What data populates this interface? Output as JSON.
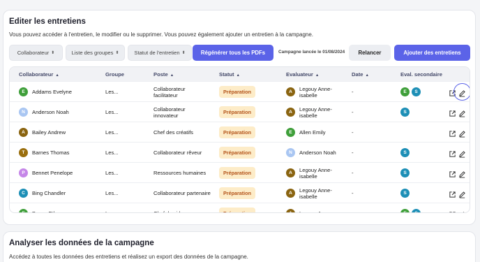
{
  "section1": {
    "title": "Editer les entretiens",
    "description": "Vous pouvez accéder à l'entretien, le modifier ou le supprimer. Vous pouvez également ajouter un entretien à la campagne."
  },
  "filters": {
    "collaborateur": "Collaborateur",
    "groupes": "Liste des groupes",
    "statut": "Statut de l'entretien"
  },
  "actions": {
    "regenerate": "Régénérer tous les PDFs",
    "campaign_info": "Campagne lancée le 01/08/2024",
    "relancer": "Relancer",
    "add": "Ajouter des entretiens"
  },
  "table": {
    "headers": {
      "collaborateur": "Collaborateur",
      "groupe": "Groupe",
      "poste": "Poste",
      "statut": "Statut",
      "evaluateur": "Evaluateur",
      "date": "Date",
      "eval_secondaire": "Eval. secondaire"
    },
    "rows": [
      {
        "avatar": "E",
        "name": "Addams Evelyne",
        "groupe": "Les...",
        "poste1": "Collaborateur",
        "poste2": "facilitateur",
        "statut": "Préparation",
        "eval_avatar": "A",
        "eval1": "Legouy Anne-",
        "eval2": "isabelle",
        "date": "-",
        "sec1": "E",
        "sec2": "S"
      },
      {
        "avatar": "N",
        "name": "Anderson Noah",
        "groupe": "Les...",
        "poste1": "Collaborateur",
        "poste2": "innovateur",
        "statut": "Préparation",
        "eval_avatar": "A",
        "eval1": "Legouy Anne-",
        "eval2": "isabelle",
        "date": "-",
        "sec1": "S",
        "sec2": ""
      },
      {
        "avatar": "A",
        "name": "Bailey Andrew",
        "groupe": "Les...",
        "poste1": "Chef des créatifs",
        "poste2": "",
        "statut": "Préparation",
        "eval_avatar": "E",
        "eval1": "Allen Emily",
        "eval2": "",
        "date": "-",
        "sec1": "",
        "sec2": ""
      },
      {
        "avatar": "T",
        "name": "Barnes Thomas",
        "groupe": "Les...",
        "poste1": "Collaborateur rêveur",
        "poste2": "",
        "statut": "Préparation",
        "eval_avatar": "N",
        "eval1": "Anderson Noah",
        "eval2": "",
        "date": "-",
        "sec1": "S",
        "sec2": ""
      },
      {
        "avatar": "P",
        "name": "Bennet Penelope",
        "groupe": "Les...",
        "poste1": "Ressources humaines",
        "poste2": "",
        "statut": "Préparation",
        "eval_avatar": "A",
        "eval1": "Legouy Anne-",
        "eval2": "isabelle",
        "date": "-",
        "sec1": "S",
        "sec2": ""
      },
      {
        "avatar": "C",
        "name": "Bing Chandler",
        "groupe": "Les...",
        "poste1": "Collaborateur partenaire",
        "poste2": "",
        "statut": "Préparation",
        "eval_avatar": "A",
        "eval1": "Legouy Anne-",
        "eval2": "isabelle",
        "date": "-",
        "sec1": "S",
        "sec2": ""
      },
      {
        "avatar": "E",
        "name": "Brown Ethan",
        "groupe": "Les...",
        "poste1": "Chef des idea",
        "poste2": "",
        "statut": "Préparation",
        "eval_avatar": "A",
        "eval1": "Legouy Anne-",
        "eval2": "",
        "date": "-",
        "sec1": "E",
        "sec2": "S"
      }
    ]
  },
  "section2": {
    "title": "Analyser les données de la campagne",
    "description": "Accédez à toutes les données des entretiens et réalisez un export des données de la campagne."
  },
  "colors": {
    "primary": "#5b63e8",
    "green": "#3f9f3a",
    "teal": "#1d8fb6",
    "olive": "#9a6f0e",
    "lightblue": "#a9c6f2",
    "purple": "#c586e8",
    "brown": "#8a6410",
    "badge_bg": "#fdecc8",
    "badge_fg": "#b4541a"
  },
  "icons": [
    "sort-icon",
    "external-link-icon",
    "edit-icon"
  ]
}
